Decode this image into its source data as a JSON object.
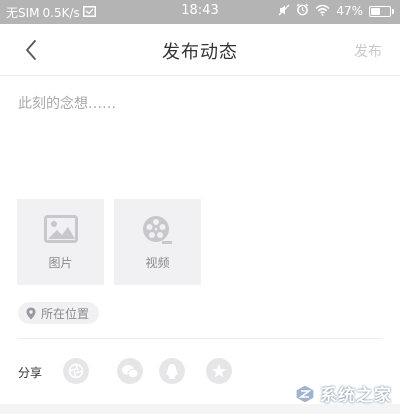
{
  "status_bar": {
    "carrier": "无SIM",
    "network_speed": "0.5K/s",
    "time": "18:43",
    "battery_percent": "47%",
    "battery_level": 0.47
  },
  "nav": {
    "title": "发布动态",
    "publish_label": "发布"
  },
  "compose": {
    "placeholder": "此刻的念想……",
    "value": ""
  },
  "media": {
    "image_label": "图片",
    "video_label": "视频"
  },
  "location": {
    "label": "所在位置"
  },
  "share": {
    "label": "分享",
    "targets": [
      "moments-icon",
      "wechat-icon",
      "qq-icon",
      "qzone-icon"
    ]
  },
  "watermark": {
    "text": "系统之家"
  },
  "colors": {
    "status_bar_bg": "#b4b4b4",
    "tile_bg": "#f1f1f3",
    "icon_gray": "#c8c8cc",
    "disabled_text": "#c9c9c9"
  }
}
